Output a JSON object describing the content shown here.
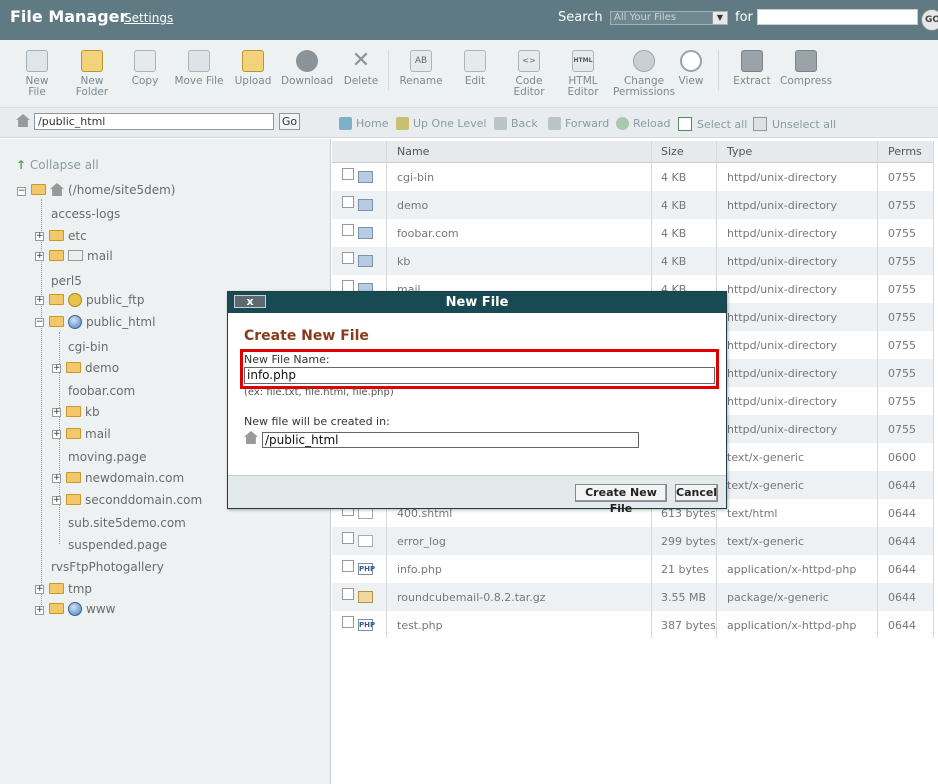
{
  "header": {
    "title": "File Manager",
    "settings": "Settings",
    "search_label": "Search",
    "search_scope": "All Your Files",
    "for_label": "for",
    "search_value": "",
    "go": "GO"
  },
  "toolbar": {
    "new_file": [
      "New",
      "File"
    ],
    "new_folder": [
      "New",
      "Folder"
    ],
    "copy": "Copy",
    "move_file": "Move File",
    "upload": "Upload",
    "download": "Download",
    "delete": "Delete",
    "rename": "Rename",
    "edit": "Edit",
    "code_editor": [
      "Code",
      "Editor"
    ],
    "html_editor": [
      "HTML",
      "Editor"
    ],
    "change_permissions": [
      "Change",
      "Permissions"
    ],
    "view": "View",
    "extract": "Extract",
    "compress": "Compress"
  },
  "pathbar": {
    "path": "/public_html",
    "go": "Go"
  },
  "nav": {
    "home": "Home",
    "up_one_level": "Up One Level",
    "back": "Back",
    "forward": "Forward",
    "reload": "Reload",
    "select_all": "Select all",
    "unselect_all": "Unselect all"
  },
  "tree": {
    "collapse_all": "Collapse all",
    "root": "(/home/site5dem)",
    "items": {
      "access_logs": "access-logs",
      "etc": "etc",
      "mail": "mail",
      "perl5": "perl5",
      "public_ftp": "public_ftp",
      "public_html": "public_html",
      "cgi_bin": "cgi-bin",
      "demo": "demo",
      "foobar": "foobar.com",
      "kb": "kb",
      "mail2": "mail",
      "moving": "moving.page",
      "newdomain": "newdomain.com",
      "seconddomain": "seconddomain.com",
      "sub": "sub.site5demo.com",
      "suspended": "suspended.page",
      "rvsftp": "rvsFtpPhotogallery",
      "tmp": "tmp",
      "www": "www"
    }
  },
  "table": {
    "headers": {
      "name": "Name",
      "size": "Size",
      "type": "Type",
      "perms": "Perms"
    },
    "rows": [
      {
        "name": "cgi-bin",
        "size": "4 KB",
        "type": "httpd/unix-directory",
        "perms": "0755"
      },
      {
        "name": "demo",
        "size": "4 KB",
        "type": "httpd/unix-directory",
        "perms": "0755"
      },
      {
        "name": "foobar.com",
        "size": "4 KB",
        "type": "httpd/unix-directory",
        "perms": "0755"
      },
      {
        "name": "kb",
        "size": "4 KB",
        "type": "httpd/unix-directory",
        "perms": "0755"
      },
      {
        "name": "mail",
        "size": "4 KB",
        "type": "httpd/unix-directory",
        "perms": "0755"
      },
      {
        "name": "",
        "size": "",
        "type": "httpd/unix-directory",
        "perms": "0755"
      },
      {
        "name": "",
        "size": "",
        "type": "httpd/unix-directory",
        "perms": "0755"
      },
      {
        "name": "",
        "size": "",
        "type": "httpd/unix-directory",
        "perms": "0755"
      },
      {
        "name": "",
        "size": "",
        "type": "httpd/unix-directory",
        "perms": "0755"
      },
      {
        "name": "",
        "size": "",
        "type": "httpd/unix-directory",
        "perms": "0755"
      },
      {
        "name": "",
        "size": "",
        "type": "text/x-generic",
        "perms": "0600"
      },
      {
        "name": "",
        "size": "",
        "type": "text/x-generic",
        "perms": "0644"
      },
      {
        "name": "400.shtml",
        "size": "613 bytes",
        "type": "text/html",
        "perms": "0644"
      },
      {
        "name": "error_log",
        "size": "299 bytes",
        "type": "text/x-generic",
        "perms": "0644"
      },
      {
        "name": "info.php",
        "size": "21 bytes",
        "type": "application/x-httpd-php",
        "perms": "0644"
      },
      {
        "name": "roundcubemail-0.8.2.tar.gz",
        "size": "3.55 MB",
        "type": "package/x-generic",
        "perms": "0644"
      },
      {
        "name": "test.php",
        "size": "387 bytes",
        "type": "application/x-httpd-php",
        "perms": "0644"
      }
    ]
  },
  "modal": {
    "close": "x",
    "title": "New File",
    "heading": "Create New File",
    "name_label": "New File Name:",
    "name_value": "info.php",
    "hint": "(ex: file.txt, file.html, file.php)",
    "location_label": "New file will be created in:",
    "location_value": "/public_html",
    "create_button": "Create New File",
    "cancel_button": "Cancel"
  },
  "colors": {
    "header_bg": "#5f7a82",
    "modal_title_bg": "#174a52",
    "highlight": "#e00000",
    "heading": "#8b3a1a"
  }
}
